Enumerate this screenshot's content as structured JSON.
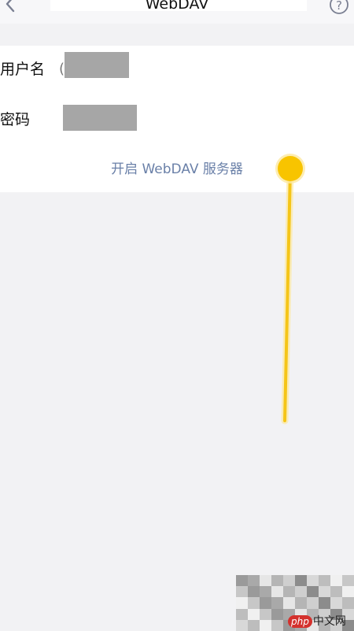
{
  "navbar": {
    "title": "WebDAV",
    "back_icon": "chevron-left-icon",
    "help_icon": "question-circle-icon",
    "help_glyph": "?"
  },
  "form": {
    "username_label": "用户名",
    "password_label": "密码",
    "username_hint": "(",
    "enable_label": "开启 WebDAV 服务器"
  },
  "watermark": {
    "php": "php",
    "site": "中文网"
  },
  "colors": {
    "accent_link": "#6a80a8",
    "gesture": "#f5c518"
  }
}
